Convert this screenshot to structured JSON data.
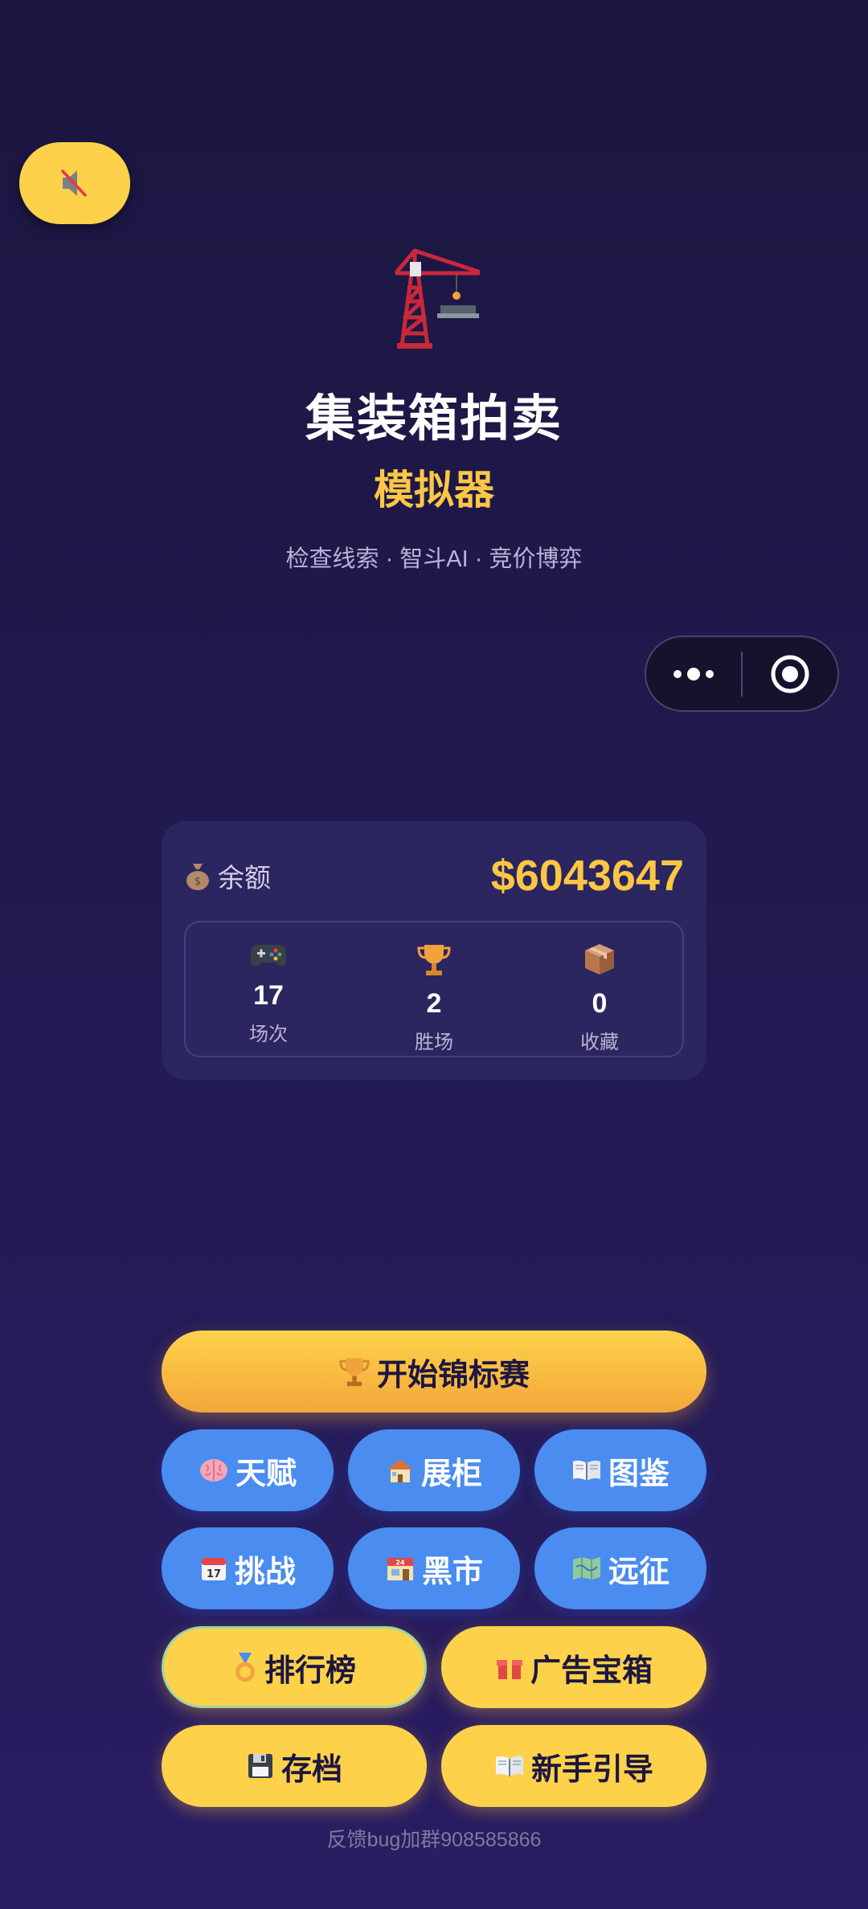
{
  "header": {
    "title": "集装箱拍卖",
    "subtitle": "模拟器",
    "tagline": "检查线索 · 智斗AI · 竞价博弈"
  },
  "icons": {
    "sound": "muted-speaker-icon",
    "logo": "crane-icon",
    "capsule_more": "more-dots-icon",
    "capsule_close": "target-circle-icon"
  },
  "colors": {
    "accent_yellow": "#fdd24a",
    "accent_blue": "#4a8cf0",
    "balance": "#fdc743",
    "background": "#211a4f"
  },
  "card": {
    "balance_label": "余额",
    "balance_value": "$6043647",
    "stats": [
      {
        "icon": "gamepad-icon",
        "value": "17",
        "label": "场次"
      },
      {
        "icon": "trophy-icon",
        "value": "2",
        "label": "胜场"
      },
      {
        "icon": "box-icon",
        "value": "0",
        "label": "收藏"
      }
    ]
  },
  "buttons": {
    "start": "开始锦标赛",
    "talent": "天赋",
    "cabinet": "展柜",
    "catalog": "图鉴",
    "challenge": "挑战",
    "black_market": "黑市",
    "expedition": "远征",
    "leaderboard": "排行榜",
    "ad_chest": "广告宝箱",
    "save": "存档",
    "guide": "新手引导"
  },
  "footer": "反馈bug加群908585866"
}
